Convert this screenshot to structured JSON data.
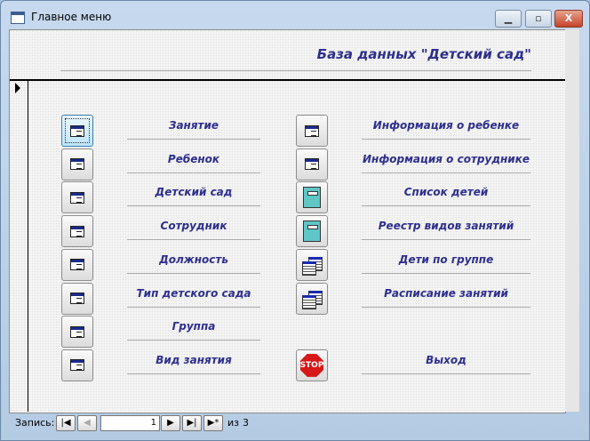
{
  "window": {
    "title": "Главное меню",
    "min": "▁",
    "max": "▫",
    "close": "X"
  },
  "header": {
    "title": "База данных \"Детский сад\""
  },
  "left_items": [
    {
      "label": "Занятие",
      "icon": "form-icon"
    },
    {
      "label": "Ребенок",
      "icon": "form-icon"
    },
    {
      "label": "Детский сад",
      "icon": "form-icon"
    },
    {
      "label": "Сотрудник",
      "icon": "form-icon"
    },
    {
      "label": "Должность",
      "icon": "form-icon"
    },
    {
      "label": "Тип детского сада",
      "icon": "form-icon"
    },
    {
      "label": "Группа",
      "icon": "form-icon"
    },
    {
      "label": "Вид занятия",
      "icon": "form-icon"
    }
  ],
  "right_items": [
    {
      "label": "Информация о ребенке",
      "icon": "form-icon"
    },
    {
      "label": "Информация о сотруднике",
      "icon": "form-icon"
    },
    {
      "label": "Список детей",
      "icon": "report-icon"
    },
    {
      "label": "Реестр видов занятий",
      "icon": "report-icon"
    },
    {
      "label": "Дети по группе",
      "icon": "query-icon"
    },
    {
      "label": "Расписание занятий",
      "icon": "query-icon"
    }
  ],
  "exit": {
    "label": "Выход",
    "icon_text": "STOP"
  },
  "navigation": {
    "label": "Запись:",
    "current": "1",
    "of": "из",
    "total": "3",
    "first": "|◀",
    "prev": "◀",
    "next": "▶",
    "last": "▶|",
    "new": "▶*"
  }
}
